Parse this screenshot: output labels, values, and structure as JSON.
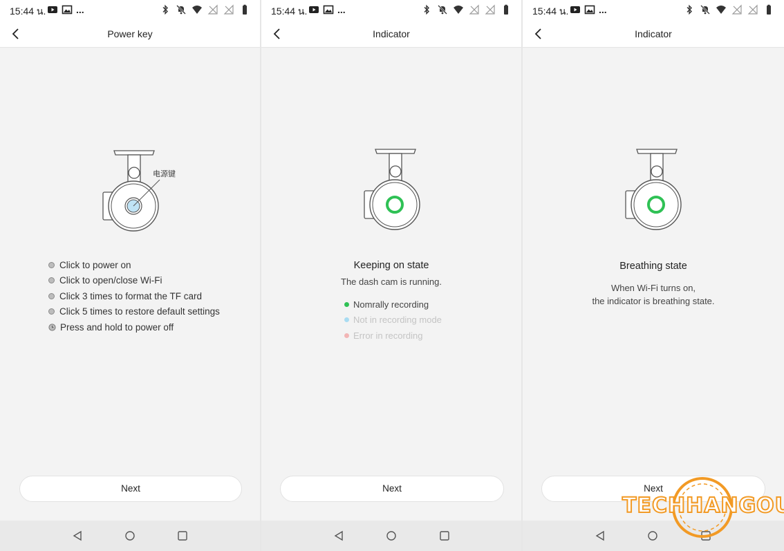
{
  "status_bar": {
    "time": "15:44 น.",
    "overflow": "..."
  },
  "screens": [
    {
      "title": "Power key",
      "illustration_label": "电源键",
      "items": [
        "Click to power on",
        "Click to open/close Wi-Fi",
        "Click 3 times to format the TF card",
        "Click 5 times to restore default settings",
        "Press and hold to power off"
      ],
      "next_label": "Next"
    },
    {
      "title": "Indicator",
      "state_title": "Keeping on state",
      "state_desc": "The dash cam is running.",
      "legend": [
        {
          "label": "Nomrally recording",
          "color": "#2fc155",
          "text_color": "#444444"
        },
        {
          "label": "Not in recording mode",
          "color": "#a9dcf2",
          "text_color": "#c4c4c4"
        },
        {
          "label": "Error in recording",
          "color": "#f2b5b5",
          "text_color": "#c4c4c4"
        }
      ],
      "next_label": "Next"
    },
    {
      "title": "Indicator",
      "state_title": "Breathing state",
      "state_desc_line1": "When Wi-Fi turns on,",
      "state_desc_line2": "the indicator is breathing state.",
      "next_label": "Next"
    }
  ],
  "colors": {
    "indicator_green": "#2fc155",
    "power_key_blue": "#bfe3f5",
    "watermark_orange": "#f29a25"
  },
  "watermark": "TECHHANGOUT"
}
